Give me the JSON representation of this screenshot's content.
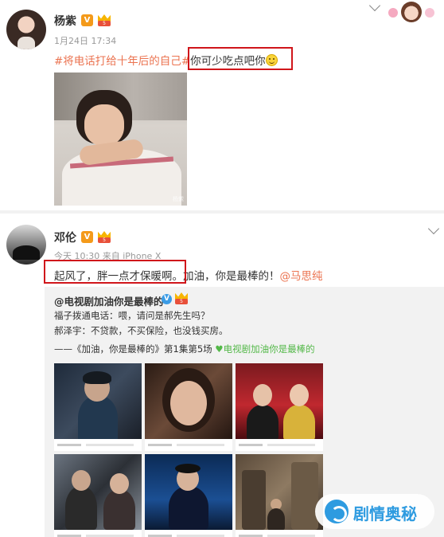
{
  "post1": {
    "user_name": "杨紫",
    "v_badge": "V",
    "level_badge": "5",
    "timestamp": "1月24日 17:34",
    "hashtag": "#将电话打给十年后的自己#",
    "body": "你可少吃点吧你",
    "emoji": "smiley-emoji",
    "image_watermark": "杨紫",
    "more_icon": "chevron-down-icon"
  },
  "post2": {
    "user_name": "邓伦",
    "v_badge": "V",
    "level_badge": "5",
    "meta": "今天 10:30 来自 iPhone X",
    "body_highlight": "起风了，胖一点才保暖啊。",
    "body_rest": "加油，你是最棒的！",
    "mention": "@马思纯",
    "more_icon": "chevron-down-icon"
  },
  "quoted": {
    "author": "@电视剧加油你是最棒的",
    "verified_badge": "V",
    "level_badge": "5",
    "line1": "福子拨通电话：喂，请问是郝先生吗？",
    "line2": "郝泽宇：不贷款，不买保险，也没钱买房。",
    "line3_prefix": "——《加油，你是最棒的》第1集第5场",
    "line3_topic": "电视剧加油你是最棒的",
    "topic_icon": "heart-icon"
  },
  "watermark_brand": "剧情奥秘",
  "colors": {
    "link_orange": "#eb7350",
    "topic_green": "#53b848",
    "highlight_red": "#d0161b",
    "brand_blue": "#2e9be0"
  }
}
